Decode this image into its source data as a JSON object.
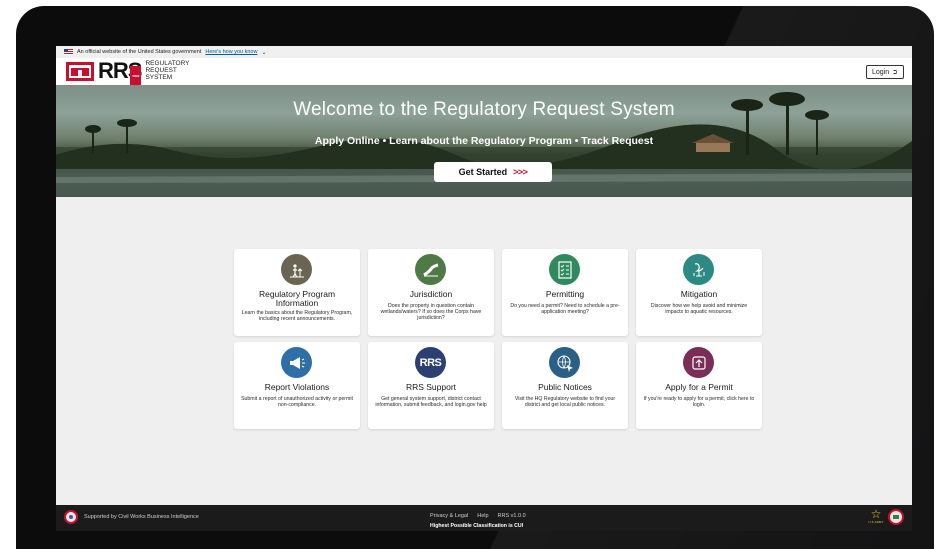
{
  "gov_banner": {
    "text": "An official website of the United States government",
    "link": "Here's how you know"
  },
  "header": {
    "logo_mark": "RRS",
    "logo_badge": "WEB",
    "logo_line1": "REGULATORY",
    "logo_line2": "REQUEST",
    "logo_line3": "SYSTEM",
    "login_label": "Login",
    "login_icon": "sign-in-icon"
  },
  "hero": {
    "title": "Welcome to the Regulatory Request System",
    "tagline": "Apply Online • Learn about the Regulatory Program • Track Request",
    "cta_label": "Get Started",
    "cta_arrows": ">>>"
  },
  "cards": [
    {
      "title": "Regulatory Program Information",
      "desc": "Learn the basics about the Regulatory Program, including recent announcements.",
      "icon": "wetland-person-icon",
      "color": "#6b6452"
    },
    {
      "title": "Jurisdiction",
      "desc": "Does the property in question contain wetlands/waters? If so does the Corps have jurisdiction?",
      "icon": "river-icon",
      "color": "#4f7a45"
    },
    {
      "title": "Permitting",
      "desc": "Do you need a permit? Need to schedule a pre-application meeting?",
      "icon": "checklist-icon",
      "color": "#2f8a5d"
    },
    {
      "title": "Mitigation",
      "desc": "Discover how we help avoid and minimize impacts to aquatic resources.",
      "icon": "heron-icon",
      "color": "#2c8a83"
    },
    {
      "title": "Report Violations",
      "desc": "Submit a report of unauthorized activity or permit non-compliance.",
      "icon": "megaphone-icon",
      "color": "#2f6fa8"
    },
    {
      "title": "RRS Support",
      "desc": "Get general system support, district contact information, submit feedback, and login.gov help",
      "icon": "rrs-logo-icon",
      "color": "#2b3f73"
    },
    {
      "title": "Public Notices",
      "desc": "Visit the HQ Regulatory website to find your district and get local public notices.",
      "icon": "globe-cursor-icon",
      "color": "#2a5f86"
    },
    {
      "title": "Apply for a Permit",
      "desc": "If you're ready to apply for a permit, click here to login.",
      "icon": "upload-box-icon",
      "color": "#7a2e57"
    }
  ],
  "footer": {
    "supported_by": "Supported by Civil Works Business Intelligence",
    "privacy": "Privacy & Legal",
    "help": "Help",
    "version": "RRS v1.0.0",
    "classification": "Highest Possible Classification is CUI",
    "army_label": "U.S.ARMY"
  }
}
